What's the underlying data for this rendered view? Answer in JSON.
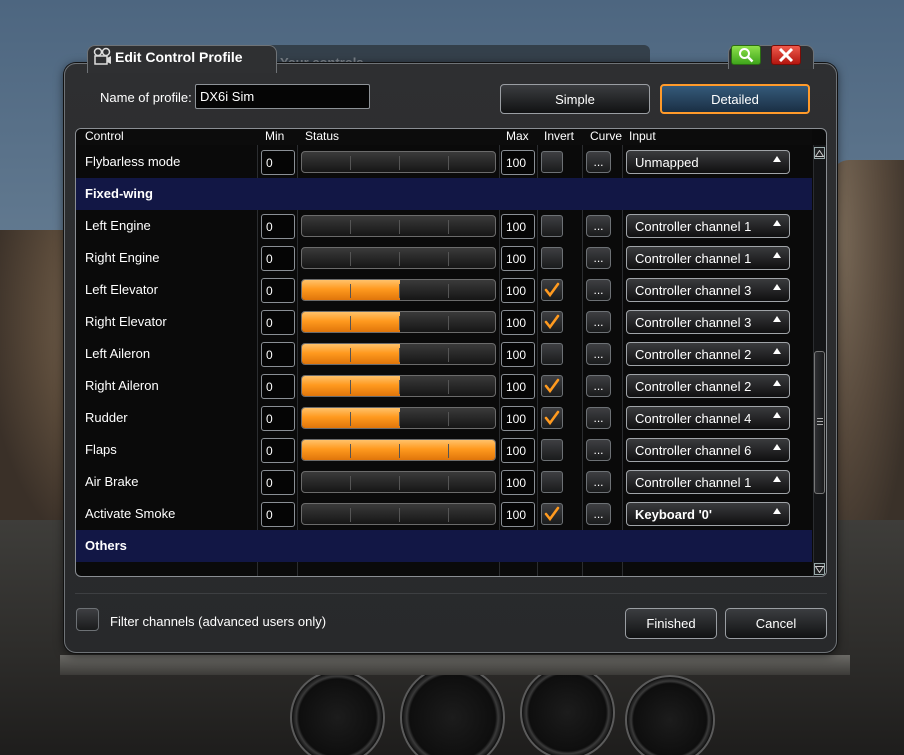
{
  "window": {
    "title": "Edit Control Profile",
    "background_ghost_title": "Your controls"
  },
  "profile": {
    "name_label": "Name of profile:",
    "name_value": "DX6i Sim"
  },
  "mode_buttons": {
    "simple_label": "Simple",
    "detailed_label": "Detailed",
    "selected": "Detailed"
  },
  "table": {
    "columns": {
      "control": "Control",
      "min": "Min",
      "status": "Status",
      "max": "Max",
      "invert": "Invert",
      "curve": "Curve",
      "input": "Input"
    },
    "curve_button_label": "...",
    "rows": [
      {
        "type": "control",
        "label": "Flybarless mode",
        "min": "0",
        "max": "100",
        "status": 0.0,
        "invert": false,
        "input": "Unmapped",
        "input_bold": false
      },
      {
        "type": "section",
        "label": "Fixed-wing"
      },
      {
        "type": "control",
        "label": "Left Engine",
        "min": "0",
        "max": "100",
        "status": 0.0,
        "invert": false,
        "input": "Controller channel 1",
        "input_bold": false
      },
      {
        "type": "control",
        "label": "Right Engine",
        "min": "0",
        "max": "100",
        "status": 0.0,
        "invert": false,
        "input": "Controller channel 1",
        "input_bold": false
      },
      {
        "type": "control",
        "label": "Left Elevator",
        "min": "0",
        "max": "100",
        "status": 0.5,
        "invert": true,
        "input": "Controller channel 3",
        "input_bold": false
      },
      {
        "type": "control",
        "label": "Right Elevator",
        "min": "0",
        "max": "100",
        "status": 0.5,
        "invert": true,
        "input": "Controller channel 3",
        "input_bold": false
      },
      {
        "type": "control",
        "label": "Left Aileron",
        "min": "0",
        "max": "100",
        "status": 0.5,
        "invert": false,
        "input": "Controller channel 2",
        "input_bold": false
      },
      {
        "type": "control",
        "label": "Right Aileron",
        "min": "0",
        "max": "100",
        "status": 0.5,
        "invert": true,
        "input": "Controller channel 2",
        "input_bold": false
      },
      {
        "type": "control",
        "label": "Rudder",
        "min": "0",
        "max": "100",
        "status": 0.5,
        "invert": true,
        "input": "Controller channel 4",
        "input_bold": false
      },
      {
        "type": "control",
        "label": "Flaps",
        "min": "0",
        "max": "100",
        "status": 1.0,
        "invert": false,
        "input": "Controller channel 6",
        "input_bold": false
      },
      {
        "type": "control",
        "label": "Air Brake",
        "min": "0",
        "max": "100",
        "status": 0.0,
        "invert": false,
        "input": "Controller channel 1",
        "input_bold": false
      },
      {
        "type": "control",
        "label": "Activate Smoke",
        "min": "0",
        "max": "100",
        "status": 0.0,
        "invert": true,
        "input": "Keyboard '0'",
        "input_bold": true
      },
      {
        "type": "section",
        "label": "Others"
      }
    ]
  },
  "filter": {
    "label": "Filter channels (advanced users only)",
    "checked": false
  },
  "footer": {
    "finished_label": "Finished",
    "cancel_label": "Cancel"
  },
  "colors": {
    "accent_orange": "#ff9a1f",
    "section_bg": "#121745",
    "search_green": "#5cc52a",
    "close_red": "#d0281c"
  },
  "icons": {
    "title": "film-projector-icon",
    "search": "magnifier-icon",
    "close": "close-x-icon",
    "scroll_up": "triangle-up-icon",
    "scroll_down": "triangle-down-icon"
  }
}
